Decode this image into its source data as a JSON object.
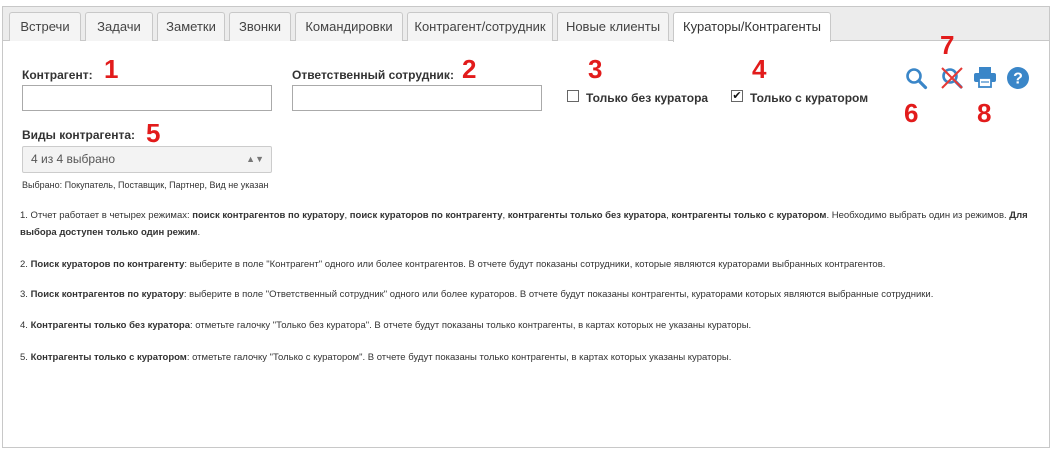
{
  "tabs": [
    {
      "label": "Встречи"
    },
    {
      "label": "Задачи"
    },
    {
      "label": "Заметки"
    },
    {
      "label": "Звонки"
    },
    {
      "label": "Командировки"
    },
    {
      "label": "Контрагент/сотрудник"
    },
    {
      "label": "Новые клиенты"
    },
    {
      "label": "Кураторы/Контрагенты",
      "active": true
    }
  ],
  "form": {
    "contragent_label": "Контрагент:",
    "contragent_value": "",
    "employee_label": "Ответственный сотрудник:",
    "employee_value": "",
    "no_curator_label": "Только без куратора",
    "no_curator_checked": false,
    "with_curator_label": "Только с куратором",
    "with_curator_checked": true,
    "types_label": "Виды контрагента:",
    "types_value": "4 из 4 выбрано",
    "types_selected_note": "Выбрано: Покупатель, Поставщик, Партнер, Вид не указан"
  },
  "toolbar": {
    "icons": [
      "search-icon",
      "clear-search-icon",
      "print-icon",
      "help-icon"
    ]
  },
  "markers": [
    "1",
    "2",
    "3",
    "4",
    "5",
    "6",
    "7",
    "8"
  ],
  "description": {
    "p1_a": "1. Отчет работает в четырех режимах: ",
    "p1_b": "поиск контрагентов по куратору",
    "p1_c": ", ",
    "p1_d": "поиск кураторов по контрагенту",
    "p1_e": ", ",
    "p1_f": "контрагенты только без куратора",
    "p1_g": ", ",
    "p1_h": "контрагенты только с куратором",
    "p1_i": ". Необходимо выбрать один из режимов. ",
    "p1_j": "Для выбора доступен только один режим",
    "p1_k": ".",
    "p2_a": "2. ",
    "p2_b": "Поиск кураторов по контрагенту",
    "p2_c": ": выберите в поле \"Контрагент\" одного или более контрагентов. В отчете будут показаны сотрудники, которые являются кураторами выбранных контрагентов.",
    "p3_a": "3. ",
    "p3_b": "Поиск контрагентов по куратору",
    "p3_c": ": выберите в поле \"Ответственный сотрудник\" одного или более кураторов. В отчете будут показаны контрагенты, кураторами которых являются выбранные сотрудники.",
    "p4_a": "4. ",
    "p4_b": "Контрагенты только без куратора",
    "p4_c": ": отметьте галочку \"Только без куратора\". В отчете будут показаны только контрагенты, в картах которых не указаны кураторы.",
    "p5_a": "5. ",
    "p5_b": "Контрагенты только с куратором",
    "p5_c": ": отметьте галочку \"Только с куратором\". В отчете будут показаны только контрагенты, в картах которых указаны кураторы."
  },
  "colors": {
    "accent": "#3a86c8",
    "marker": "#e21b1b",
    "clear_x": "#e53935"
  }
}
